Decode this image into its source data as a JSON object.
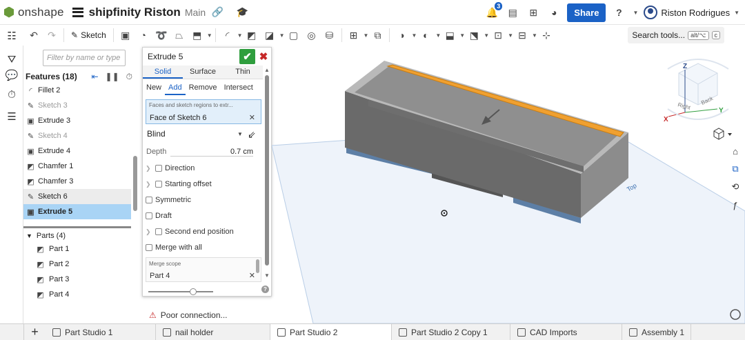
{
  "topbar": {
    "logo_text": "onshape",
    "doc_title": "shipfinity Riston",
    "branch": "Main",
    "notification_count": "3",
    "share_label": "Share",
    "user_name": "Riston Rodrigues"
  },
  "toolbar": {
    "sketch_label": "Sketch",
    "search_label": "Search tools...",
    "search_shortcut_1": "alt/⌥",
    "search_shortcut_2": "c"
  },
  "feature_panel": {
    "filter_placeholder": "Filter by name or type",
    "features_header": "Features (18)",
    "features": [
      {
        "label": "Fillet 2",
        "state": "normal"
      },
      {
        "label": "Sketch 3",
        "state": "dim"
      },
      {
        "label": "Extrude 3",
        "state": "normal"
      },
      {
        "label": "Sketch 4",
        "state": "dim"
      },
      {
        "label": "Extrude 4",
        "state": "normal"
      },
      {
        "label": "Chamfer 1",
        "state": "normal"
      },
      {
        "label": "Chamfer 3",
        "state": "normal"
      },
      {
        "label": "Sketch 6",
        "state": "hover"
      },
      {
        "label": "Extrude 5",
        "state": "selected"
      }
    ],
    "parts_header": "Parts (4)",
    "parts": [
      "Part 1",
      "Part 2",
      "Part 3",
      "Part 4"
    ]
  },
  "dialog": {
    "title": "Extrude 5",
    "type_tabs": [
      "Solid",
      "Surface",
      "Thin"
    ],
    "type_active": "Solid",
    "op_tabs": [
      "New",
      "Add",
      "Remove",
      "Intersect"
    ],
    "op_active": "Add",
    "faces_placeholder": "Faces and sketch regions to extr...",
    "faces_value": "Face of Sketch 6",
    "end_type": "Blind",
    "depth_label": "Depth",
    "depth_value": "0.7 cm",
    "direction_label": "Direction",
    "starting_offset_label": "Starting offset",
    "symmetric_label": "Symmetric",
    "draft_label": "Draft",
    "second_end_label": "Second end position",
    "merge_all_label": "Merge with all",
    "merge_scope_placeholder": "Merge scope",
    "merge_scope_value": "Part 4"
  },
  "status": {
    "connection": "Poor connection..."
  },
  "viewcube": {
    "z_label": "Z",
    "x_label": "X",
    "y_label": "Y",
    "front_label": "Right",
    "side_label": "Back",
    "plane_label": "Top"
  },
  "bottom_tabs": [
    {
      "label": "Part Studio 1",
      "active": false
    },
    {
      "label": "nail holder",
      "active": false
    },
    {
      "label": "Part Studio 2",
      "active": true
    },
    {
      "label": "Part Studio 2 Copy 1",
      "active": false
    },
    {
      "label": "CAD Imports",
      "active": false
    },
    {
      "label": "Assembly 1",
      "active": false
    }
  ],
  "colors": {
    "accent": "#1b62c6",
    "confirm": "#2f9e3e",
    "cancel": "#c62828",
    "selection": "#a9d4f5",
    "highlight_edge": "#f0a030"
  }
}
